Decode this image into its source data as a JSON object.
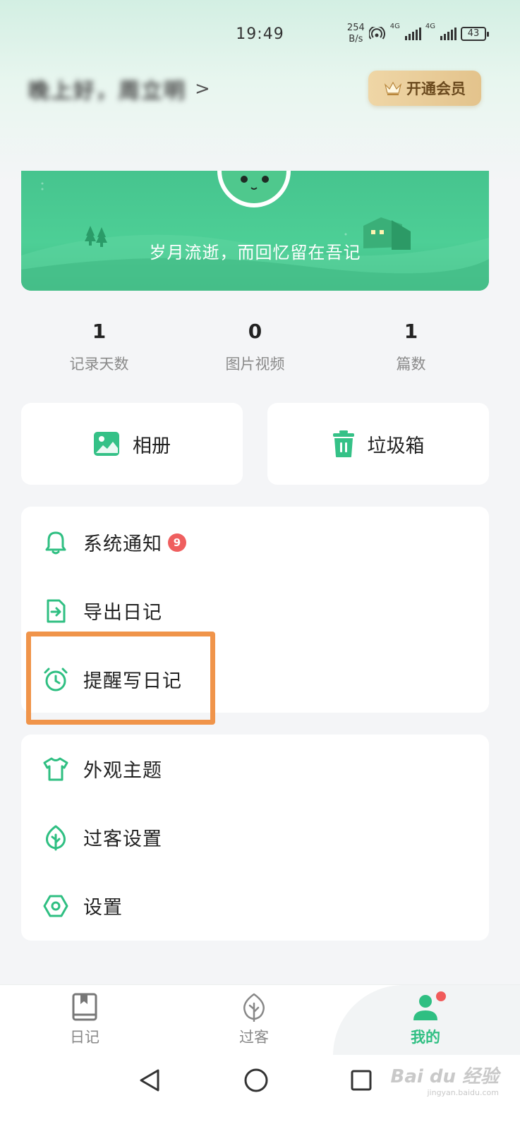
{
  "status_bar": {
    "time": "19:49",
    "net_speed_value": "254",
    "net_speed_unit": "B/s",
    "sim1_label": "4G",
    "sim2_label": "4G",
    "battery": "43"
  },
  "header": {
    "greeting": "晚上好，周立明",
    "vip_button": "开通会员"
  },
  "banner": {
    "slogan": "岁月流逝，而回忆留在吾记"
  },
  "stats": [
    {
      "value": "1",
      "label": "记录天数"
    },
    {
      "value": "0",
      "label": "图片视频"
    },
    {
      "value": "1",
      "label": "篇数"
    }
  ],
  "quick_actions": {
    "album": "相册",
    "trash": "垃圾箱"
  },
  "menu_group_1": [
    {
      "label": "系统通知",
      "icon": "bell-icon",
      "badge": "9"
    },
    {
      "label": "导出日记",
      "icon": "export-icon"
    },
    {
      "label": "提醒写日记",
      "icon": "alarm-clock-icon"
    }
  ],
  "menu_group_2": [
    {
      "label": "外观主题",
      "icon": "tshirt-icon"
    },
    {
      "label": "过客设置",
      "icon": "leaf-icon"
    },
    {
      "label": "设置",
      "icon": "hexagon-settings-icon"
    }
  ],
  "bottom_nav": {
    "tabs": [
      {
        "label": "日记",
        "icon": "diary-book-icon"
      },
      {
        "label": "过客",
        "icon": "leaf-icon"
      },
      {
        "label": "我的",
        "icon": "person-icon",
        "active": true
      }
    ]
  },
  "watermark": {
    "brand": "Bai du 经验",
    "url": "jingyan.baidu.com"
  },
  "colors": {
    "accent": "#2fbf82",
    "highlight": "#f0944a",
    "badge": "#ef5f5f",
    "vip_gold": "#e3c38c"
  }
}
